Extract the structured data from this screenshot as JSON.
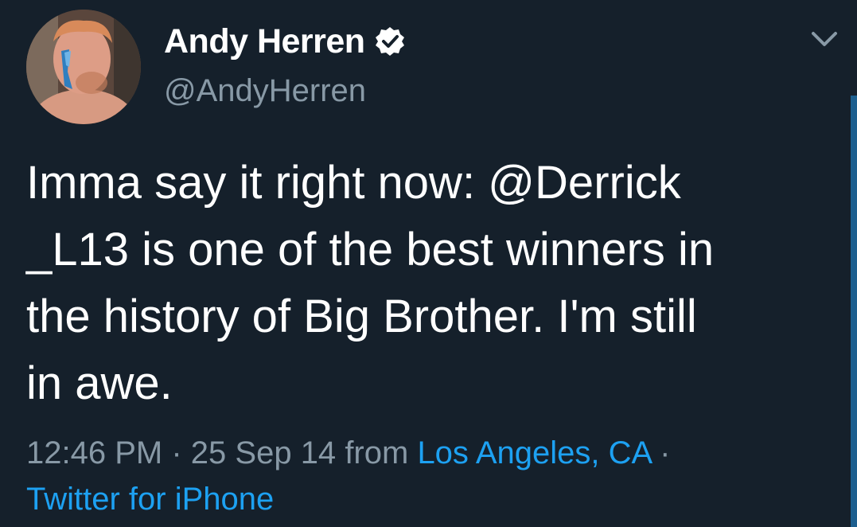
{
  "tweet": {
    "display_name": "Andy Herren",
    "handle": "@AndyHerren",
    "verified": true,
    "text_lines": [
      "Imma say it right now: @Derrick",
      "_L13 is one of the best winners in",
      "the history of Big Brother. I'm still",
      "in awe."
    ],
    "time": "12:46 PM",
    "separator": "·",
    "date": "25 Sep 14",
    "from_label": "from",
    "location": "Los Angeles, CA",
    "client": "Twitter for iPhone"
  },
  "icons": {
    "verified": "verified-badge-icon",
    "caret": "chevron-down-icon"
  },
  "colors": {
    "background": "#15202b",
    "text": "#ffffff",
    "secondary": "#8899a6",
    "link": "#1da1f2"
  }
}
